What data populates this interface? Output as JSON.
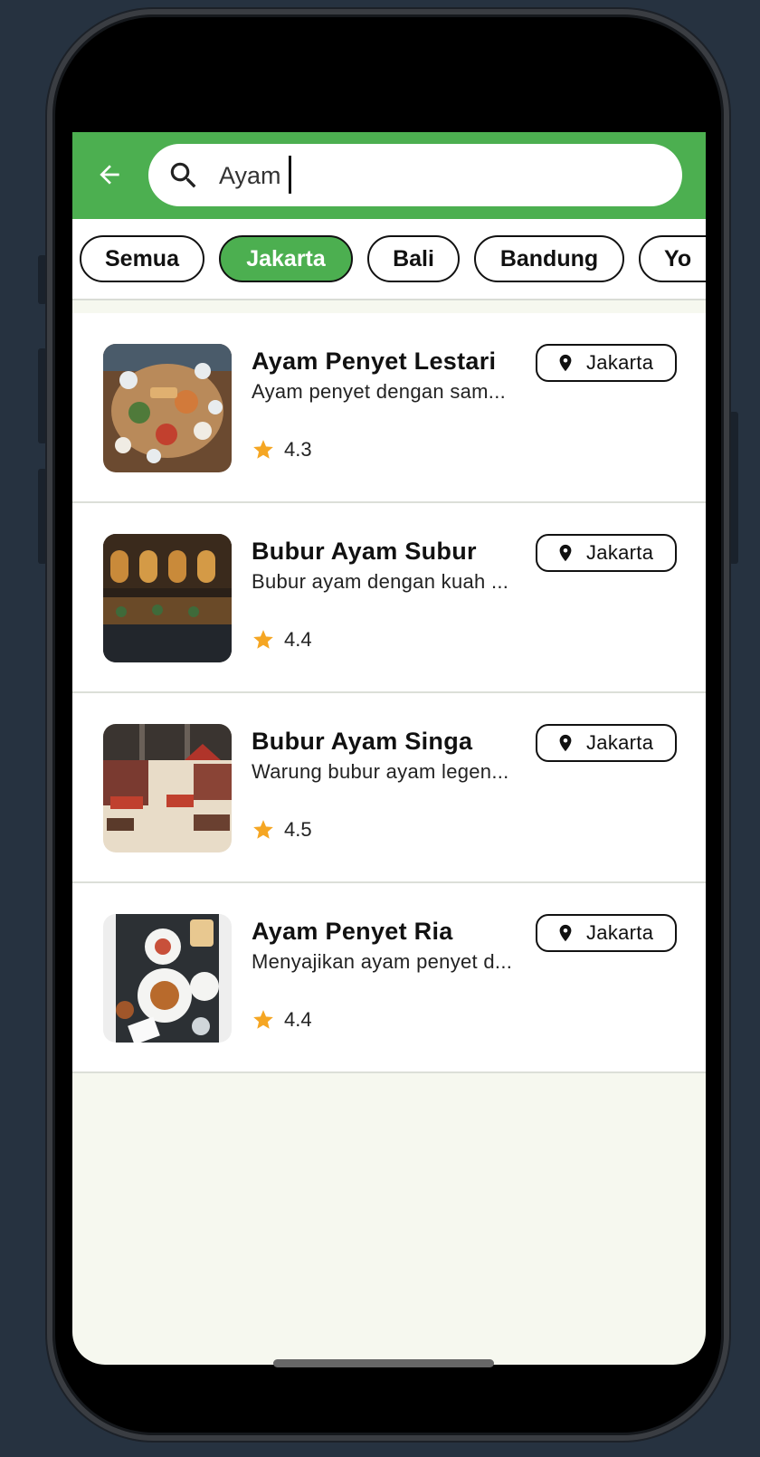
{
  "search": {
    "query": "Ayam",
    "back_label": "back"
  },
  "colors": {
    "primary": "#4caf50",
    "star": "#f5a623",
    "screen_bg": "#f6f8ef"
  },
  "filters": [
    {
      "label": "Semua",
      "active": false
    },
    {
      "label": "Jakarta",
      "active": true
    },
    {
      "label": "Bali",
      "active": false
    },
    {
      "label": "Bandung",
      "active": false
    },
    {
      "label": "Yo",
      "active": false
    }
  ],
  "restaurants": [
    {
      "name": "Ayam Penyet Lestari",
      "description": "Ayam penyet dengan sam...",
      "rating": "4.3",
      "location": "Jakarta",
      "image": "food-table-photo"
    },
    {
      "name": "Bubur Ayam Subur",
      "description": "Bubur ayam dengan kuah ...",
      "rating": "4.4",
      "location": "Jakarta",
      "image": "restaurant-exterior-night-photo"
    },
    {
      "name": "Bubur Ayam Singa",
      "description": "Warung bubur ayam legen...",
      "rating": "4.5",
      "location": "Jakarta",
      "image": "restaurant-interior-photo"
    },
    {
      "name": "Ayam Penyet Ria",
      "description": "Menyajikan ayam penyet d...",
      "rating": "4.4",
      "location": "Jakarta",
      "image": "dishes-flatlay-photo"
    }
  ]
}
